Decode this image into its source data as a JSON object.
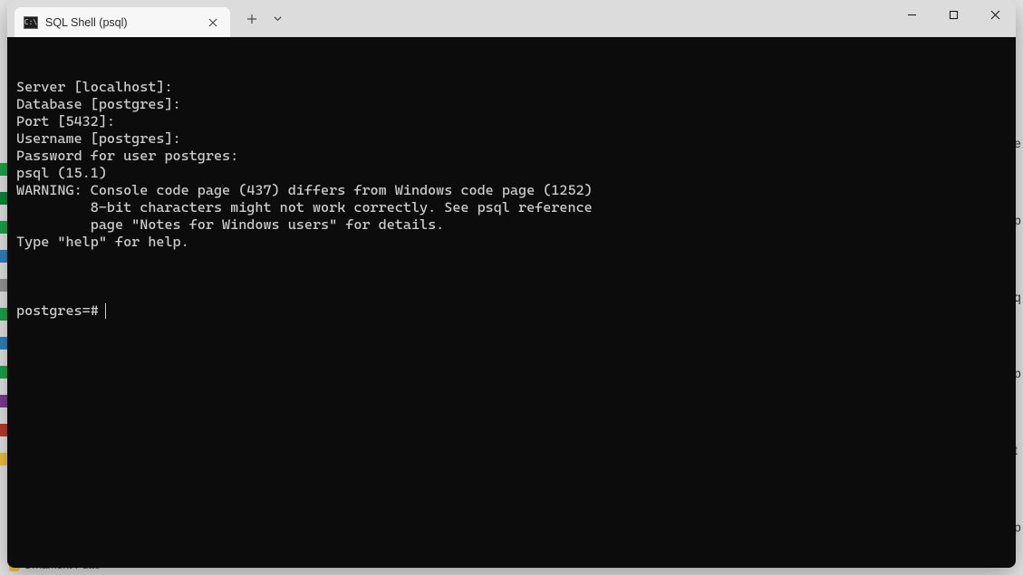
{
  "background": {
    "bottom_left_text": "Ornament Putte"
  },
  "titlebar": {
    "tab_title": "SQL Shell (psql)",
    "tab_icon_text": "C:\\"
  },
  "terminal": {
    "lines": [
      "Server [localhost]:",
      "Database [postgres]:",
      "Port [5432]:",
      "Username [postgres]:",
      "Password for user postgres:",
      "psql (15.1)",
      "WARNING: Console code page (437) differs from Windows code page (1252)",
      "         8-bit characters might not work correctly. See psql reference",
      "         page \"Notes for Windows users\" for details.",
      "Type \"help\" for help.",
      ""
    ],
    "prompt": "postgres=#"
  }
}
